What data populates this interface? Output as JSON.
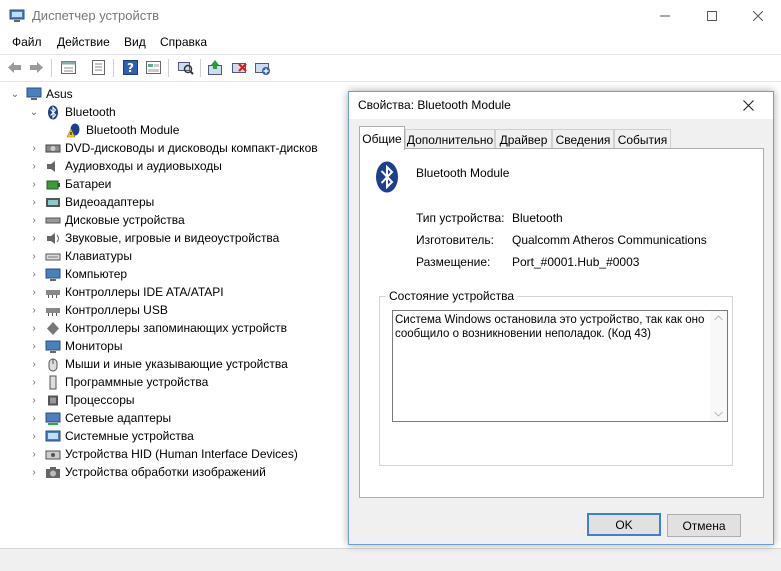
{
  "window": {
    "title": "Диспетчер устройств",
    "icons": {
      "minimize": "minimize-icon",
      "maximize": "maximize-icon",
      "close": "close-icon"
    }
  },
  "menu": [
    "Файл",
    "Действие",
    "Вид",
    "Справка"
  ],
  "toolbar": [
    "back-icon",
    "forward-icon",
    "properties-icon",
    "show-hidden-icon",
    "help-icon",
    "view-icon",
    "scan-icon",
    "update-driver-icon",
    "disable-icon",
    "uninstall-icon"
  ],
  "tree": {
    "root": "Asus",
    "bluetooth": {
      "label": "Bluetooth",
      "child": "Bluetooth Module"
    },
    "categories": [
      "DVD-дисководы и дисководы компакт-дисков",
      "Аудиовходы и аудиовыходы",
      "Батареи",
      "Видеоадаптеры",
      "Дисковые устройства",
      "Звуковые, игровые и видеоустройства",
      "Клавиатуры",
      "Компьютер",
      "Контроллеры IDE ATA/ATAPI",
      "Контроллеры USB",
      "Контроллеры запоминающих устройств",
      "Мониторы",
      "Мыши и иные указывающие устройства",
      "Программные устройства",
      "Процессоры",
      "Сетевые адаптеры",
      "Системные устройства",
      "Устройства HID (Human Interface Devices)",
      "Устройства обработки изображений"
    ]
  },
  "dialog": {
    "title": "Свойства: Bluetooth Module",
    "tabs": [
      "Общие",
      "Дополнительно",
      "Драйвер",
      "Сведения",
      "События"
    ],
    "device_name": "Bluetooth Module",
    "props": {
      "type_label": "Тип устройства:",
      "type_value": "Bluetooth",
      "maker_label": "Изготовитель:",
      "maker_value": "Qualcomm Atheros Communications",
      "place_label": "Размещение:",
      "place_value": "Port_#0001.Hub_#0003"
    },
    "status_title": "Состояние устройства",
    "status_text": "Система Windows остановила это устройство, так как оно сообщило о возникновении неполадок. (Код 43)",
    "ok_label": "OK",
    "cancel_label": "Отмена"
  }
}
